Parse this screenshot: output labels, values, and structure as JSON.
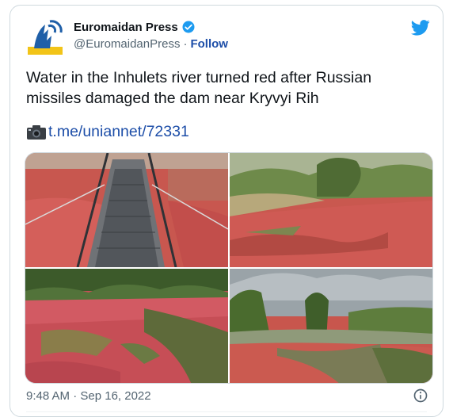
{
  "author": {
    "name": "Euromaidan Press",
    "handle": "@EuromaidanPress",
    "separator": "·",
    "follow_label": "Follow"
  },
  "tweet": {
    "text": "Water in the Inhulets river turned red after Russian missiles damaged the dam near Kryvyi Rih",
    "link_text": "t.me/uniannet/72331"
  },
  "meta": {
    "timestamp": "9:48 AM · Sep 16, 2022"
  },
  "icons": {
    "verified": "verified-badge-icon",
    "bird": "twitter-bird-icon",
    "camera": "camera-icon",
    "info": "info-icon"
  },
  "colors": {
    "verified": "#1d9bf0",
    "link": "#1d4ea8",
    "muted": "#536471",
    "river_red": "#c8423f"
  }
}
